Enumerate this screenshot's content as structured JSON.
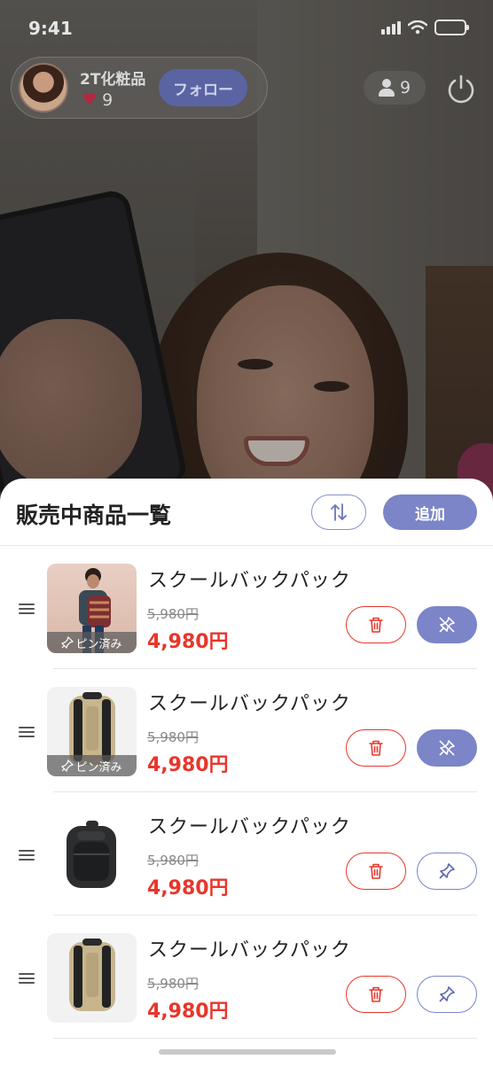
{
  "status_bar": {
    "time": "9:41"
  },
  "host": {
    "name": "2T化粧品",
    "likes": "9",
    "follow_label": "フォロー"
  },
  "viewers": {
    "count": "9"
  },
  "sheet": {
    "title": "販売中商品一覧",
    "add_label": "追加",
    "pinned_badge": "ピン済み"
  },
  "products": [
    {
      "name": "スクールバックパック",
      "old_price": "5,980円",
      "price": "4,980円",
      "pinned": true,
      "image": "model-with-backpack"
    },
    {
      "name": "スクールバックパック",
      "old_price": "5,980円",
      "price": "4,980円",
      "pinned": true,
      "image": "beige-backpack"
    },
    {
      "name": "スクールバックパック",
      "old_price": "5,980円",
      "price": "4,980円",
      "pinned": false,
      "image": "black-backpack"
    },
    {
      "name": "スクールバックパック",
      "old_price": "5,980円",
      "price": "4,980円",
      "pinned": false,
      "image": "beige-backpack"
    }
  ],
  "colors": {
    "accent": "#7b85c8",
    "price_red": "#e8362b"
  },
  "icons": [
    "heart-icon",
    "person-icon",
    "power-icon",
    "sort-icon",
    "trash-icon",
    "pin-icon",
    "unpin-icon",
    "drag-handle-icon"
  ]
}
